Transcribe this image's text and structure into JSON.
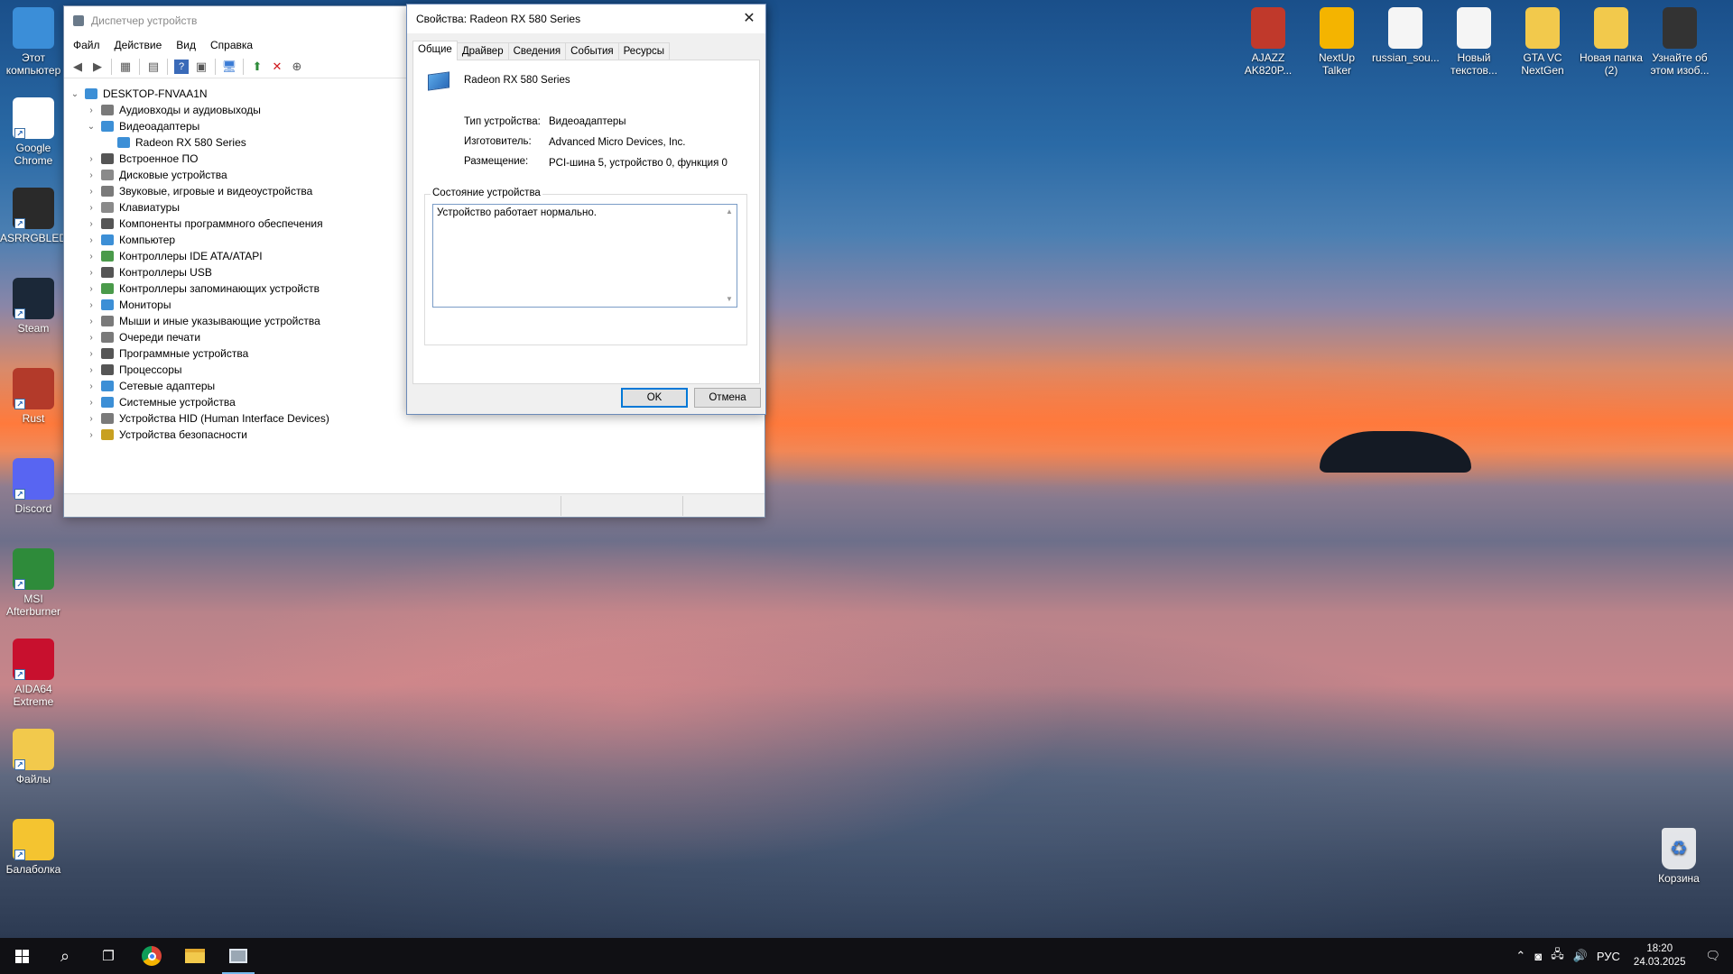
{
  "desktop": {
    "left_icons": [
      {
        "label": "Этот компьютер",
        "icon": "this-pc-icon",
        "color": "#3b8ed8"
      },
      {
        "label": "Google Chrome",
        "icon": "chrome-icon",
        "color": "#ffffff"
      },
      {
        "label": "ASRRGBLED",
        "icon": "asrock-rgb-icon",
        "color": "#2a2a2a"
      },
      {
        "label": "Steam",
        "icon": "steam-icon",
        "color": "#1b2838"
      },
      {
        "label": "Rust",
        "icon": "rust-icon",
        "color": "#b33a2a"
      },
      {
        "label": "Discord",
        "icon": "discord-icon",
        "color": "#5865f2"
      },
      {
        "label": "MSI Afterburner",
        "icon": "msi-afterburner-icon",
        "color": "#2e8b3a"
      },
      {
        "label": "AIDA64 Extreme",
        "icon": "aida64-icon",
        "color": "#c8102e"
      },
      {
        "label": "Файлы",
        "icon": "files-folder-icon",
        "color": "#f2c94c"
      },
      {
        "label": "Балаболка",
        "icon": "balabolka-icon",
        "color": "#f4c430"
      }
    ],
    "top_icons": [
      {
        "label": "AJAZZ AK820P...",
        "icon": "ajazz-icon",
        "color": "#c0392b"
      },
      {
        "label": "NextUp Talker",
        "icon": "nextup-talker-icon",
        "color": "#f4b400"
      },
      {
        "label": "russian_sou...",
        "icon": "file-icon",
        "color": "#f5f5f5"
      },
      {
        "label": "Новый текстов...",
        "icon": "text-file-icon",
        "color": "#f5f5f5"
      },
      {
        "label": "GTA VC NextGen",
        "icon": "folder-icon",
        "color": "#f2c94c"
      },
      {
        "label": "Новая папка (2)",
        "icon": "folder-icon",
        "color": "#f2c94c"
      },
      {
        "label": "Узнайте об этом изоб...",
        "icon": "camera-info-icon",
        "color": "#333333"
      }
    ],
    "recycle_bin": {
      "label": "Корзина",
      "icon": "recycle-bin-icon"
    }
  },
  "device_manager": {
    "title": "Диспетчер устройств",
    "menu": [
      "Файл",
      "Действие",
      "Вид",
      "Справка"
    ],
    "root": "DESKTOP-FNVAA1N",
    "nodes": [
      {
        "label": "Аудиовходы и аудиовыходы",
        "expanded": false,
        "icon": "audio-icon",
        "color": "#7a7a7a"
      },
      {
        "label": "Видеоадаптеры",
        "expanded": true,
        "icon": "display-adapter-icon",
        "color": "#3c8fd6",
        "children": [
          "Radeon RX 580 Series"
        ]
      },
      {
        "label": "Встроенное ПО",
        "expanded": false,
        "icon": "firmware-icon",
        "color": "#555555"
      },
      {
        "label": "Дисковые устройства",
        "expanded": false,
        "icon": "disk-icon",
        "color": "#8a8a8a"
      },
      {
        "label": "Звуковые, игровые и видеоустройства",
        "expanded": false,
        "icon": "sound-icon",
        "color": "#7a7a7a"
      },
      {
        "label": "Клавиатуры",
        "expanded": false,
        "icon": "keyboard-icon",
        "color": "#8a8a8a"
      },
      {
        "label": "Компоненты программного обеспечения",
        "expanded": false,
        "icon": "software-component-icon",
        "color": "#555555"
      },
      {
        "label": "Компьютер",
        "expanded": false,
        "icon": "computer-icon",
        "color": "#3c8fd6"
      },
      {
        "label": "Контроллеры IDE ATA/ATAPI",
        "expanded": false,
        "icon": "ide-controller-icon",
        "color": "#4a9a4a"
      },
      {
        "label": "Контроллеры USB",
        "expanded": false,
        "icon": "usb-icon",
        "color": "#555555"
      },
      {
        "label": "Контроллеры запоминающих устройств",
        "expanded": false,
        "icon": "storage-controller-icon",
        "color": "#4a9a4a"
      },
      {
        "label": "Мониторы",
        "expanded": false,
        "icon": "monitor-icon",
        "color": "#3c8fd6"
      },
      {
        "label": "Мыши и иные указывающие устройства",
        "expanded": false,
        "icon": "mouse-icon",
        "color": "#7a7a7a"
      },
      {
        "label": "Очереди печати",
        "expanded": false,
        "icon": "printer-icon",
        "color": "#7a7a7a"
      },
      {
        "label": "Программные устройства",
        "expanded": false,
        "icon": "software-device-icon",
        "color": "#555555"
      },
      {
        "label": "Процессоры",
        "expanded": false,
        "icon": "processor-icon",
        "color": "#555555"
      },
      {
        "label": "Сетевые адаптеры",
        "expanded": false,
        "icon": "network-adapter-icon",
        "color": "#3c8fd6"
      },
      {
        "label": "Системные устройства",
        "expanded": false,
        "icon": "system-device-icon",
        "color": "#3c8fd6"
      },
      {
        "label": "Устройства HID (Human Interface Devices)",
        "expanded": false,
        "icon": "hid-icon",
        "color": "#7a7a7a"
      },
      {
        "label": "Устройства безопасности",
        "expanded": false,
        "icon": "security-device-icon",
        "color": "#c8a020"
      }
    ]
  },
  "properties": {
    "title": "Свойства: Radeon RX 580 Series",
    "tabs": [
      "Общие",
      "Драйвер",
      "Сведения",
      "События",
      "Ресурсы"
    ],
    "active_tab": "Общие",
    "device_name": "Radeon RX 580 Series",
    "fields": [
      {
        "key": "Тип устройства:",
        "value": "Видеоадаптеры"
      },
      {
        "key": "Изготовитель:",
        "value": "Advanced Micro Devices, Inc."
      },
      {
        "key": "Размещение:",
        "value": "PCI-шина 5, устройство 0, функция 0"
      }
    ],
    "status_group_label": "Состояние устройства",
    "status_text": "Устройство работает нормально.",
    "ok_label": "OK",
    "cancel_label": "Отмена"
  },
  "taskbar": {
    "language": "РУС",
    "time": "18:20",
    "date": "24.03.2025",
    "accent": "#76b9ed"
  }
}
